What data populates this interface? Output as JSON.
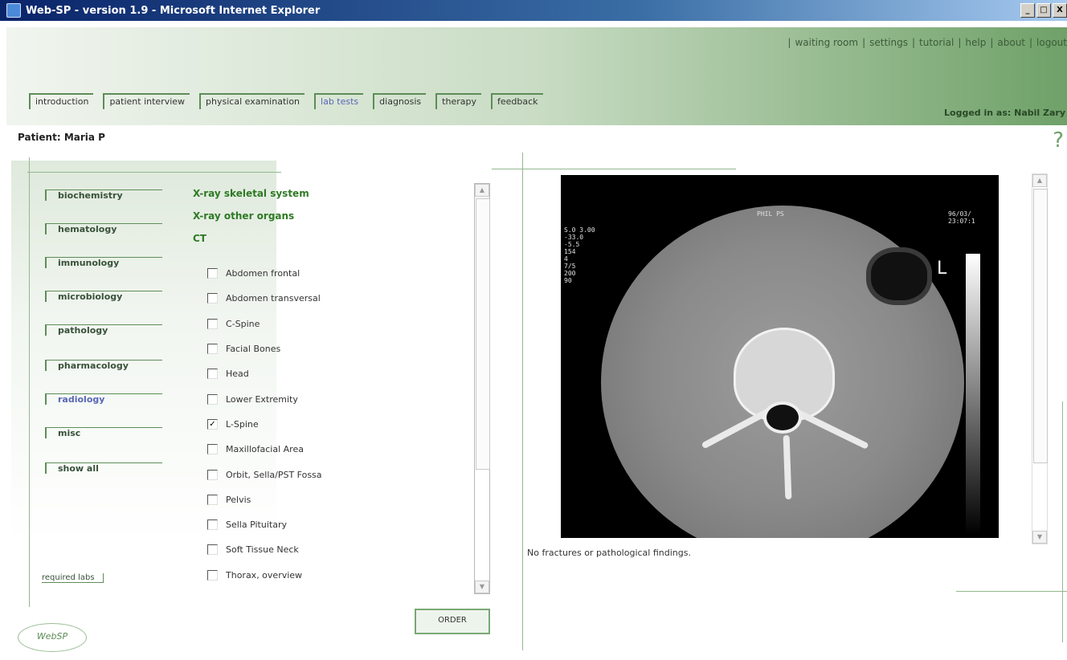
{
  "window": {
    "title": "Web-SP - version 1.9 - Microsoft Internet Explorer",
    "buttons": [
      "_",
      "□",
      "X"
    ]
  },
  "top_links": [
    "waiting room",
    "settings",
    "tutorial",
    "help",
    "about",
    "logout"
  ],
  "tabs": [
    {
      "label": "introduction",
      "active": false
    },
    {
      "label": "patient interview",
      "active": false
    },
    {
      "label": "physical examination",
      "active": false
    },
    {
      "label": "lab tests",
      "active": true
    },
    {
      "label": "diagnosis",
      "active": false
    },
    {
      "label": "therapy",
      "active": false
    },
    {
      "label": "feedback",
      "active": false
    }
  ],
  "logged_in": "Logged in as: Nabil Zary",
  "patient": "Patient: Maria P",
  "help_mark": "?",
  "categories": [
    {
      "label": "biochemistry",
      "active": false
    },
    {
      "label": "hematology",
      "active": false
    },
    {
      "label": "immunology",
      "active": false
    },
    {
      "label": "microbiology",
      "active": false
    },
    {
      "label": "pathology",
      "active": false
    },
    {
      "label": "pharmacology",
      "active": false
    },
    {
      "label": "radiology",
      "active": true
    },
    {
      "label": "misc",
      "active": false
    },
    {
      "label": "show all",
      "active": false
    }
  ],
  "required_labs": "required labs",
  "logo_text": "WebSP",
  "exam_groups": [
    "X-ray skeletal system",
    "X-ray other organs",
    "CT"
  ],
  "ct_options": [
    {
      "label": "Abdomen frontal",
      "checked": false
    },
    {
      "label": "Abdomen transversal",
      "checked": false
    },
    {
      "label": "C-Spine",
      "checked": false
    },
    {
      "label": "Facial Bones",
      "checked": false
    },
    {
      "label": "Head",
      "checked": false
    },
    {
      "label": "Lower Extremity",
      "checked": false
    },
    {
      "label": "L-Spine",
      "checked": true
    },
    {
      "label": "Maxillofacial Area",
      "checked": false
    },
    {
      "label": "Orbit, Sella/PST Fossa",
      "checked": false
    },
    {
      "label": "Pelvis",
      "checked": false
    },
    {
      "label": "Sella Pituitary",
      "checked": false
    },
    {
      "label": "Soft Tissue Neck",
      "checked": false
    },
    {
      "label": "Thorax, overview",
      "checked": false
    }
  ],
  "order_button": "ORDER",
  "ct_image": {
    "overlay_left": "S.0 3.00\n-33.0\n-5.5\n154\n4\n7/5\n200\n90",
    "overlay_top": "PHIL PS",
    "overlay_right": "96/03/\n23:07:1",
    "side_label": "L"
  },
  "caption": "No fractures or pathological findings."
}
